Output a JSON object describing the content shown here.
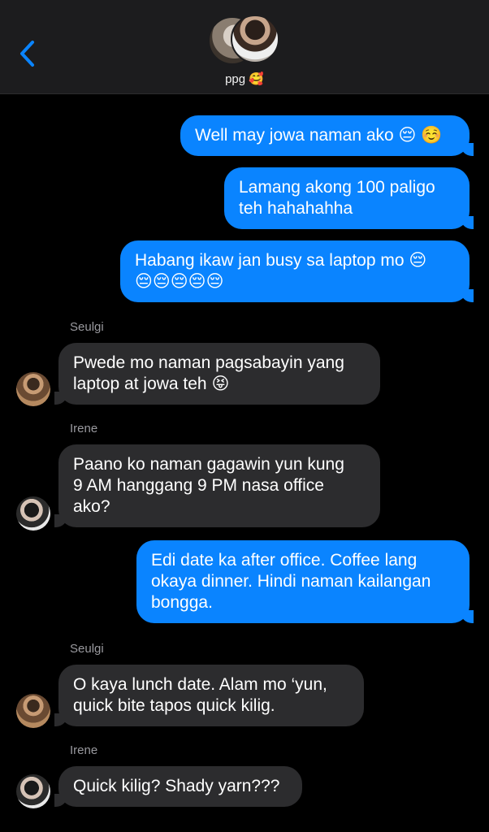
{
  "header": {
    "group_name": "ppg 🥰",
    "back_icon": "chevron-left-icon",
    "accent_color": "#0a84ff"
  },
  "messages": [
    {
      "direction": "out",
      "text": "Well may jowa naman ako 😔 ☺️"
    },
    {
      "direction": "out",
      "text": "Lamang akong 100 paligo\nteh hahahahha"
    },
    {
      "direction": "out",
      "text": "Habang ikaw jan busy sa laptop mo 😔\n😔😔😔😔😔"
    },
    {
      "direction": "in",
      "sender": "Seulgi",
      "text": "Pwede mo naman pagsabayin yang\nlaptop at jowa teh 😝"
    },
    {
      "direction": "in",
      "sender": "Irene",
      "text": "Paano ko naman gagawin yun kung\n9 AM hanggang 9 PM nasa office\nako?"
    },
    {
      "direction": "out",
      "text": "Edi date ka after office. Coffee lang\nokaya dinner. Hindi naman kailangan\nbongga."
    },
    {
      "direction": "in",
      "sender": "Seulgi",
      "text": "O kaya lunch date. Alam mo ‘yun,\nquick bite tapos quick kilig."
    },
    {
      "direction": "in",
      "sender": "Irene",
      "text": "Quick kilig? Shady yarn???"
    }
  ],
  "colors": {
    "outgoing_bubble": "#0a84ff",
    "incoming_bubble": "#2c2c2e",
    "background": "#000000"
  }
}
